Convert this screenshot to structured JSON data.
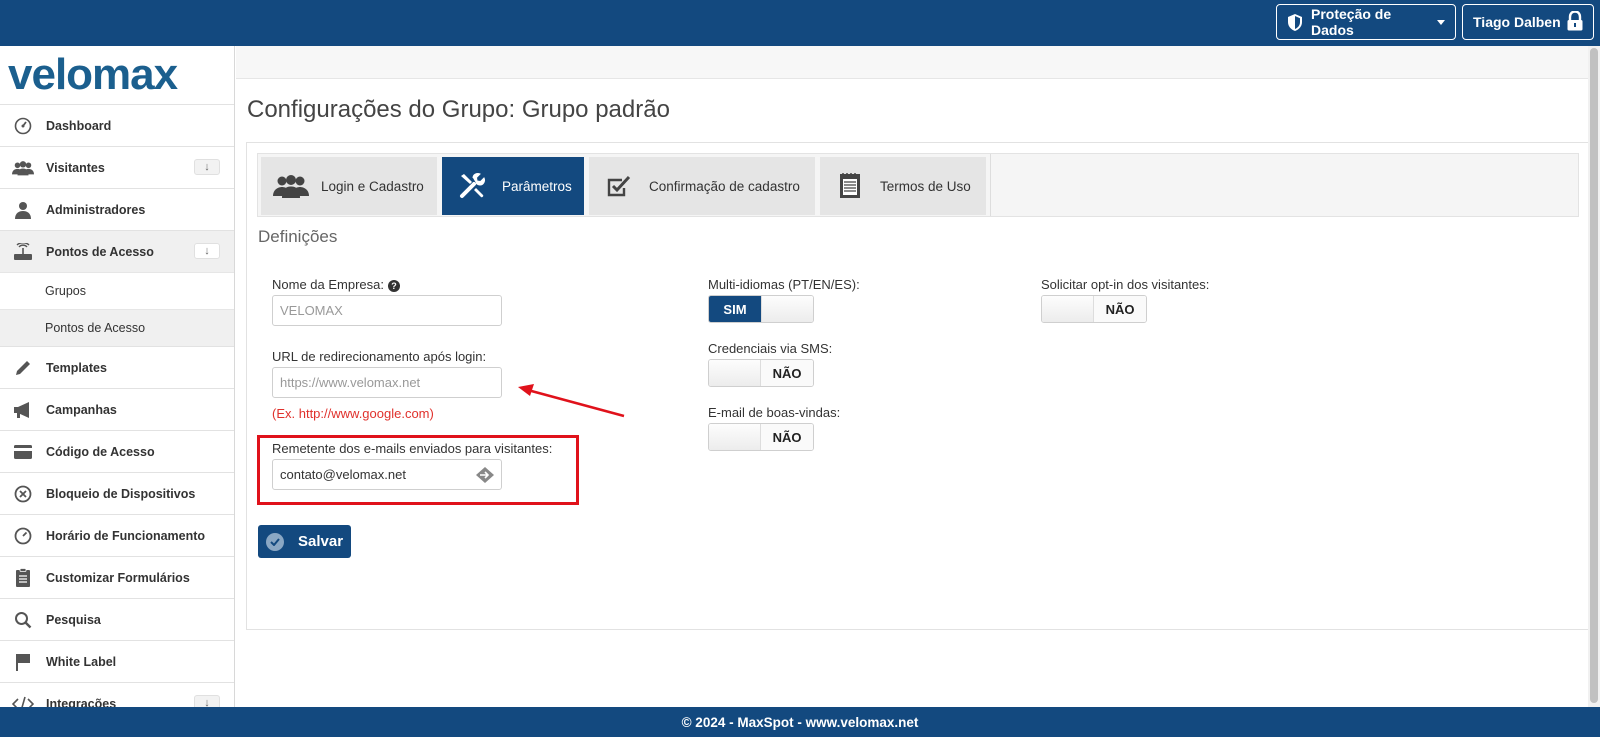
{
  "header": {
    "privacy_label": "Proteção de Dados",
    "user_label": "Tiago Dalben"
  },
  "sidebar": {
    "logo": "velomax",
    "items": [
      {
        "label": "Dashboard",
        "icon": "dashboard-icon"
      },
      {
        "label": "Visitantes",
        "icon": "users-icon",
        "expand": "↓"
      },
      {
        "label": "Administradores",
        "icon": "user-icon"
      },
      {
        "label": "Pontos de Acesso",
        "icon": "router-icon",
        "expand": "↓"
      },
      {
        "label": "Grupos"
      },
      {
        "label": "Pontos de Acesso"
      },
      {
        "label": "Templates",
        "icon": "pencil-icon"
      },
      {
        "label": "Campanhas",
        "icon": "megaphone-icon"
      },
      {
        "label": "Código de Acesso",
        "icon": "card-icon"
      },
      {
        "label": "Bloqueio de Dispositivos",
        "icon": "block-icon"
      },
      {
        "label": "Horário de Funcionamento",
        "icon": "clock-icon"
      },
      {
        "label": "Customizar Formulários",
        "icon": "clipboard-icon"
      },
      {
        "label": "Pesquisa",
        "icon": "search-icon"
      },
      {
        "label": "White Label",
        "icon": "flag-icon"
      },
      {
        "label": "Integrações",
        "icon": "code-icon",
        "expand": "↓"
      }
    ]
  },
  "main": {
    "title": "Configurações do Grupo: Grupo padrão",
    "tabs": [
      {
        "label": "Login e Cadastro"
      },
      {
        "label": "Parâmetros"
      },
      {
        "label": "Confirmação de cadastro"
      },
      {
        "label": "Termos de Uso"
      }
    ],
    "section_title": "Definições",
    "company": {
      "label": "Nome da Empresa:",
      "placeholder": "VELOMAX",
      "help": "?"
    },
    "redirect": {
      "label": "URL de redirecionamento após login:",
      "placeholder": "https://www.velomax.net",
      "hint": "(Ex. http://www.google.com)"
    },
    "sender": {
      "label": "Remetente dos e-mails enviados para visitantes:",
      "value": "contato@velomax.net"
    },
    "multilang": {
      "label": "Multi-idiomas (PT/EN/ES):",
      "state": "SIM"
    },
    "sms": {
      "label": "Credenciais via SMS:",
      "state": "NÃO"
    },
    "welcome_email": {
      "label": "E-mail de boas-vindas:",
      "state": "NÃO"
    },
    "optin": {
      "label": "Solicitar opt-in dos visitantes:",
      "state": "NÃO"
    },
    "save_label": "Salvar"
  },
  "footer": {
    "text": "© 2024 - MaxSpot - www.velomax.net"
  },
  "colors": {
    "primary": "#13497f",
    "highlight": "#e0121b",
    "hint": "#e0312c"
  }
}
